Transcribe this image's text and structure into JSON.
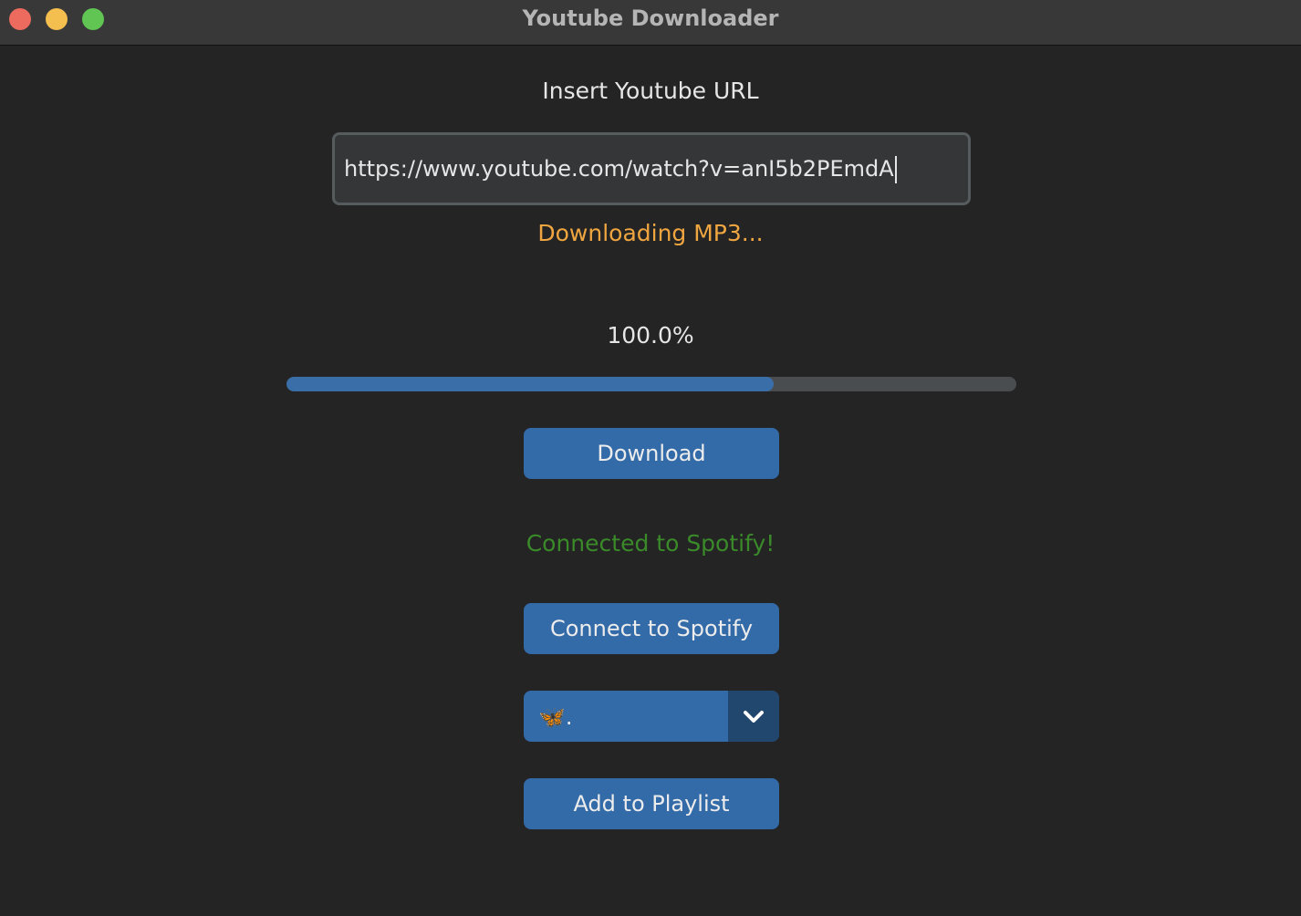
{
  "window": {
    "title": "Youtube Downloader"
  },
  "url_section": {
    "label": "Insert Youtube URL",
    "value": "https://www.youtube.com/watch?v=anI5b2PEmdA"
  },
  "download_status": "Downloading MP3...",
  "progress": {
    "label": "100.0%",
    "fill_fraction": 0.668
  },
  "buttons": {
    "download": "Download",
    "connect_spotify": "Connect to Spotify",
    "add_to_playlist": "Add to Playlist"
  },
  "spotify_status": "Connected to Spotify!",
  "playlist_select": {
    "selected": "🦋.",
    "icon": "chevron-down-icon"
  },
  "colors": {
    "status_orange": "#f0a640",
    "status_green": "#3a8a2a",
    "button_blue": "#336aa8",
    "progress_blue": "#3a6ea8"
  }
}
